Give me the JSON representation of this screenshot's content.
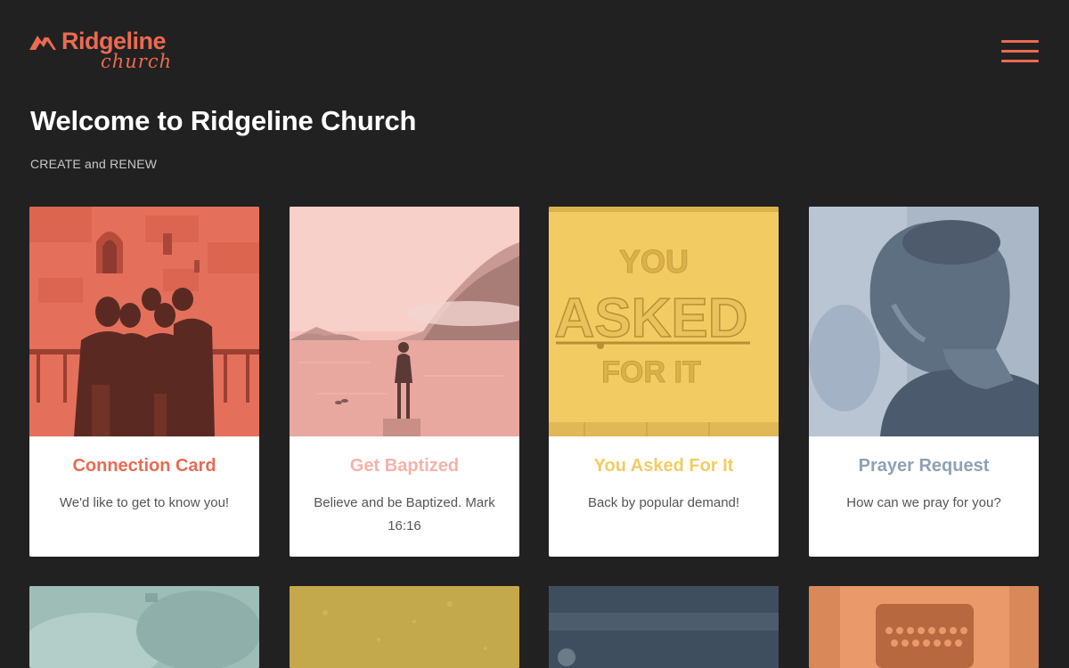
{
  "header": {
    "logo_word": "Ridgeline",
    "logo_script": "church",
    "menu_icon": "hamburger-menu-icon"
  },
  "hero": {
    "title": "Welcome to Ridgeline Church",
    "subtitle": "CREATE and RENEW"
  },
  "colors": {
    "background": "#212121",
    "brand": "#ec6a52",
    "card_connection": "#e86b53",
    "card_baptized": "#f4b3a9",
    "card_asked": "#f2cc63",
    "card_prayer": "#8ea1b6"
  },
  "cards": [
    {
      "title": "Connection Card",
      "text": "We'd like to get to know you!",
      "image": "group-of-friends-photo",
      "title_color": "#e86b53"
    },
    {
      "title": "Get Baptized",
      "text": "Believe and be Baptized. Mark 16:16",
      "image": "person-at-lake-photo",
      "title_color": "#f4b3a9"
    },
    {
      "title": "You Asked For It",
      "text": "Back by popular demand!",
      "image": "you-asked-for-it-sign",
      "image_text": [
        "YOU",
        "ASKED",
        "FOR IT"
      ],
      "title_color": "#f2cc63"
    },
    {
      "title": "Prayer Request",
      "text": "How can we pray for you?",
      "image": "man-praying-photo",
      "title_color": "#8ea1b6"
    }
  ],
  "cards_row2": [
    {
      "image": "hands-photo",
      "tint": "#9fbdb7"
    },
    {
      "image": "sunlit-field-photo",
      "tint": "#c4a84c"
    },
    {
      "image": "night-scene-photo",
      "tint": "#3f4e5e"
    },
    {
      "image": "typewriter-photo",
      "tint": "#e9996a"
    }
  ]
}
